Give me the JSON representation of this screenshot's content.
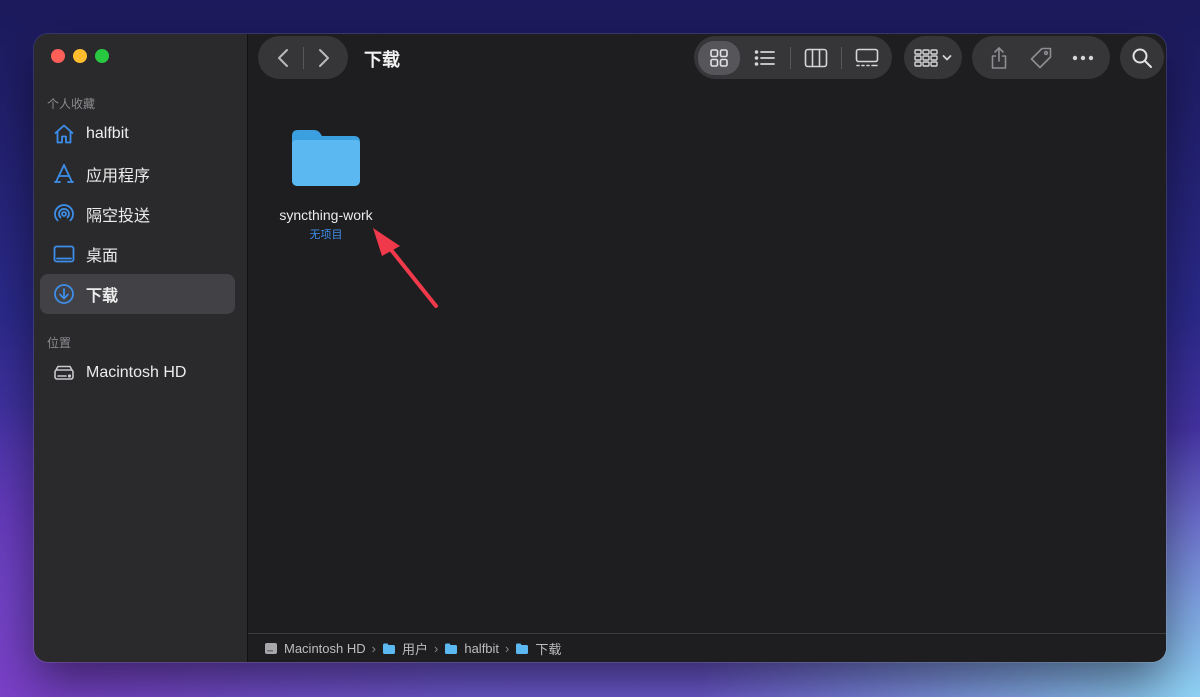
{
  "window": {
    "title": "下载"
  },
  "sidebar": {
    "favorites_label": "个人收藏",
    "locations_label": "位置",
    "favorites": [
      {
        "label": "halfbit",
        "icon": "home-icon"
      },
      {
        "label": "应用程序",
        "icon": "applications-icon"
      },
      {
        "label": "隔空投送",
        "icon": "airdrop-icon"
      },
      {
        "label": "桌面",
        "icon": "desktop-icon"
      },
      {
        "label": "下载",
        "icon": "download-icon",
        "selected": true
      }
    ],
    "locations": [
      {
        "label": "Macintosh HD",
        "icon": "hard-drive-icon"
      }
    ]
  },
  "content": {
    "items": [
      {
        "name": "syncthing-work",
        "subtitle": "无项目",
        "icon": "folder-icon"
      }
    ]
  },
  "pathbar": {
    "crumbs": [
      {
        "label": "Macintosh HD",
        "icon": "hard-drive-icon"
      },
      {
        "label": "用户",
        "icon": "folder-icon"
      },
      {
        "label": "halfbit",
        "icon": "folder-icon"
      },
      {
        "label": "下载",
        "icon": "folder-icon"
      }
    ]
  },
  "colors": {
    "accent": "#3d8ee8",
    "folder": "#5bb8f0",
    "annotation_arrow": "#f0394a"
  }
}
